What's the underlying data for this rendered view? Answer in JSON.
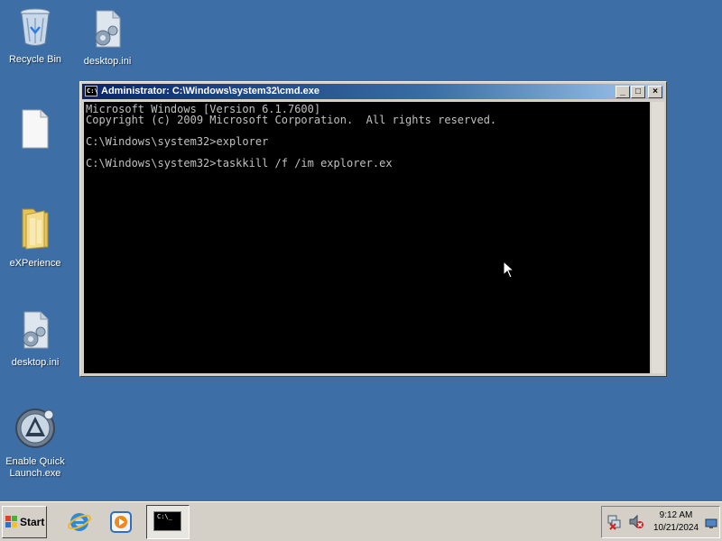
{
  "desktop": {
    "icons": [
      {
        "label": "Recycle Bin",
        "icon": "recycle-bin-icon"
      },
      {
        "label": "desktop.ini",
        "icon": "settings-file-icon"
      },
      {
        "label": "",
        "icon": "blank-file-icon"
      },
      {
        "label": "eXPerience",
        "icon": "folder-icon"
      },
      {
        "label": "desktop.ini",
        "icon": "settings-file-icon"
      },
      {
        "label": "Enable Quick Launch.exe",
        "icon": "app-launcher-icon"
      }
    ]
  },
  "window": {
    "title": "Administrator: C:\\Windows\\system32\\cmd.exe",
    "buttons": {
      "minimize": "_",
      "maximize": "□",
      "close": "×"
    },
    "console_lines": [
      "Microsoft Windows [Version 6.1.7600]",
      "Copyright (c) 2009 Microsoft Corporation.  All rights reserved.",
      "",
      "C:\\Windows\\system32>explorer",
      "",
      "C:\\Windows\\system32>taskkill /f /im explorer.ex"
    ]
  },
  "taskbar": {
    "start_label": "Start",
    "quick_launch": [
      "internet-explorer-icon",
      "media-player-icon"
    ],
    "task_icon": "C:\\_",
    "tray": {
      "time": "9:12 AM",
      "date": "10/21/2024",
      "icons": [
        "network-disconnected-icon",
        "volume-muted-icon",
        "display-icon"
      ]
    }
  },
  "colors": {
    "desktop": "#3d6ea6",
    "titlebar": "#0a246a",
    "console_bg": "#000000",
    "console_text": "#c0c0c0"
  }
}
